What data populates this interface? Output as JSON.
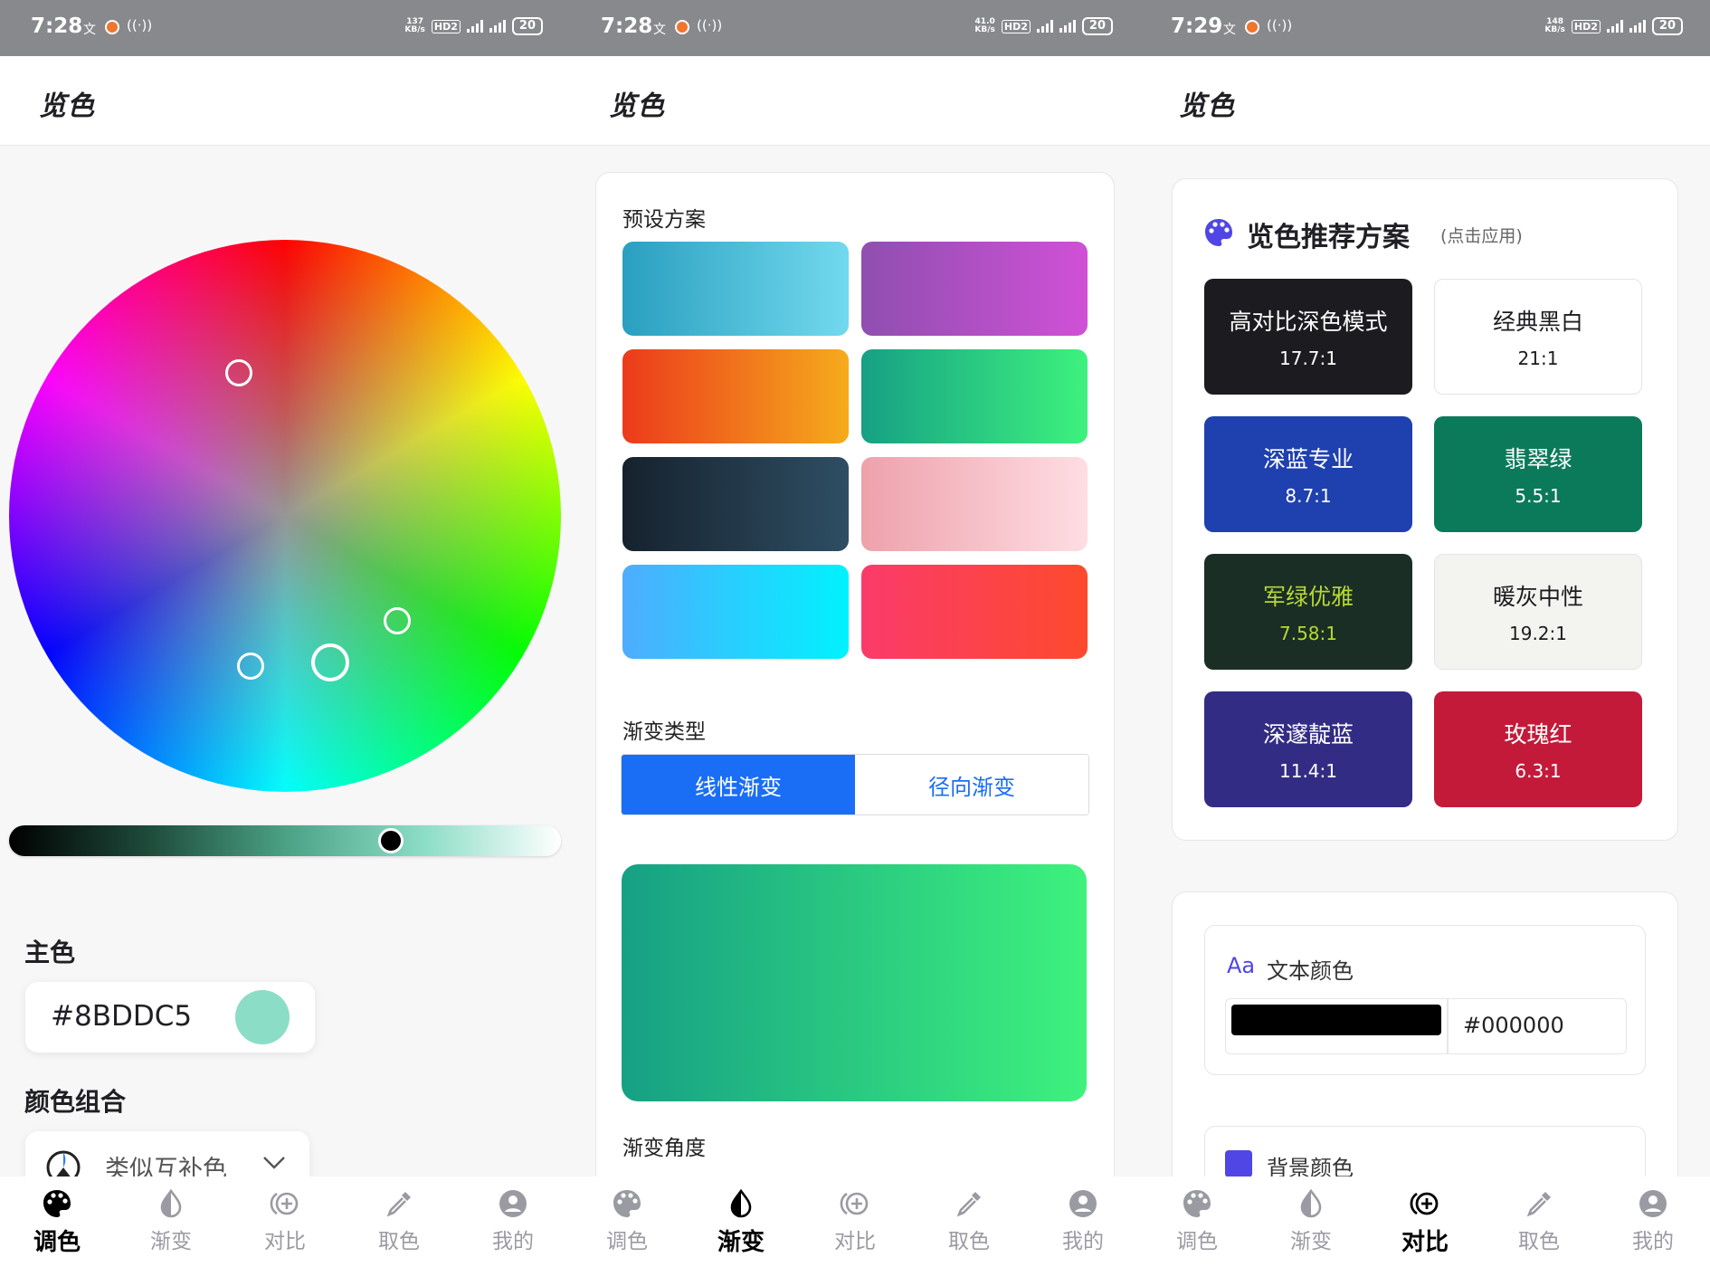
{
  "screens": [
    {
      "status": {
        "time": "7:28",
        "speed_top": "137",
        "speed_unit": "KB/s",
        "battery": "20"
      },
      "title": "览色"
    },
    {
      "status": {
        "time": "7:28",
        "speed_top": "41.0",
        "speed_unit": "KB/s",
        "battery": "20"
      },
      "title": "览色"
    },
    {
      "status": {
        "time": "7:29",
        "speed_top": "148",
        "speed_unit": "KB/s",
        "battery": "20"
      },
      "title": "览色"
    }
  ],
  "status_icons": {
    "hd": "HD2",
    "sig1": "G",
    "sig2": "5G",
    "mini": "文",
    "icons": [
      "translate-icon",
      "app-notify-icon",
      "hotspot-icon",
      "hd-voice-icon",
      "signal-icon",
      "5g-signal-icon",
      "battery-icon"
    ]
  },
  "nav": [
    {
      "label": "调色",
      "icon": "palette-icon"
    },
    {
      "label": "渐变",
      "icon": "half-drop-icon"
    },
    {
      "label": "对比",
      "icon": "contrast-plus-icon"
    },
    {
      "label": "取色",
      "icon": "eyedropper-icon"
    },
    {
      "label": "我的",
      "icon": "user-circle-icon"
    }
  ],
  "palette": {
    "primary_title": "主色",
    "hex": "#8BDDC5",
    "swatch_color": "#8bddc5",
    "combo_title": "颜色组合",
    "combo_value": "类似互补色",
    "brightness_slider": 0.69
  },
  "gradient": {
    "presets_title": "预设方案",
    "presets": [
      {
        "from": "#2a9fc0",
        "to": "#72d9ee"
      },
      {
        "from": "#8f4fb0",
        "to": "#d050d6"
      },
      {
        "from": "#ec3a1c",
        "to": "#f6ab1c"
      },
      {
        "from": "#16a085",
        "to": "#3ef27d"
      },
      {
        "from": "#16222e",
        "to": "#2e4e63"
      },
      {
        "from": "#eea1ab",
        "to": "#ffdde3"
      },
      {
        "from": "#4facfe",
        "to": "#00f2fe"
      },
      {
        "from": "#fa3b6a",
        "to": "#fd4a2d"
      }
    ],
    "type_title": "渐变类型",
    "type_options": [
      "线性渐变",
      "径向渐变"
    ],
    "angle_title": "渐变角度"
  },
  "contrast": {
    "rec_title": "览色推荐方案",
    "rec_hint": "(点击应用)",
    "schemes": [
      {
        "name": "高对比深色模式",
        "ratio": "17.7:1",
        "bg": "#1c1c20",
        "fg": "#ffffff"
      },
      {
        "name": "经典黑白",
        "ratio": "21:1",
        "bg": "#ffffff",
        "fg": "#1c1c20"
      },
      {
        "name": "深蓝专业",
        "ratio": "8.7:1",
        "bg": "#1f40af",
        "fg": "#ffffff"
      },
      {
        "name": "翡翠绿",
        "ratio": "5.5:1",
        "bg": "#0b7a5a",
        "fg": "#ffffff"
      },
      {
        "name": "军绿优雅",
        "ratio": "7.58:1",
        "bg": "#1a2e26",
        "fg": "#b7d832"
      },
      {
        "name": "暖灰中性",
        "ratio": "19.2:1",
        "bg": "#f3f3f0",
        "fg": "#1c1c20"
      },
      {
        "name": "深邃靛蓝",
        "ratio": "11.4:1",
        "bg": "#332c84",
        "fg": "#ffffff"
      },
      {
        "name": "玫瑰红",
        "ratio": "6.3:1",
        "bg": "#c41a3a",
        "fg": "#ffffff"
      }
    ],
    "text_color_prefix": "Aa",
    "text_color_label": "文本颜色",
    "text_color_hex": "#000000",
    "bg_color_label": "背景颜色",
    "accent": "#4f46e5"
  }
}
